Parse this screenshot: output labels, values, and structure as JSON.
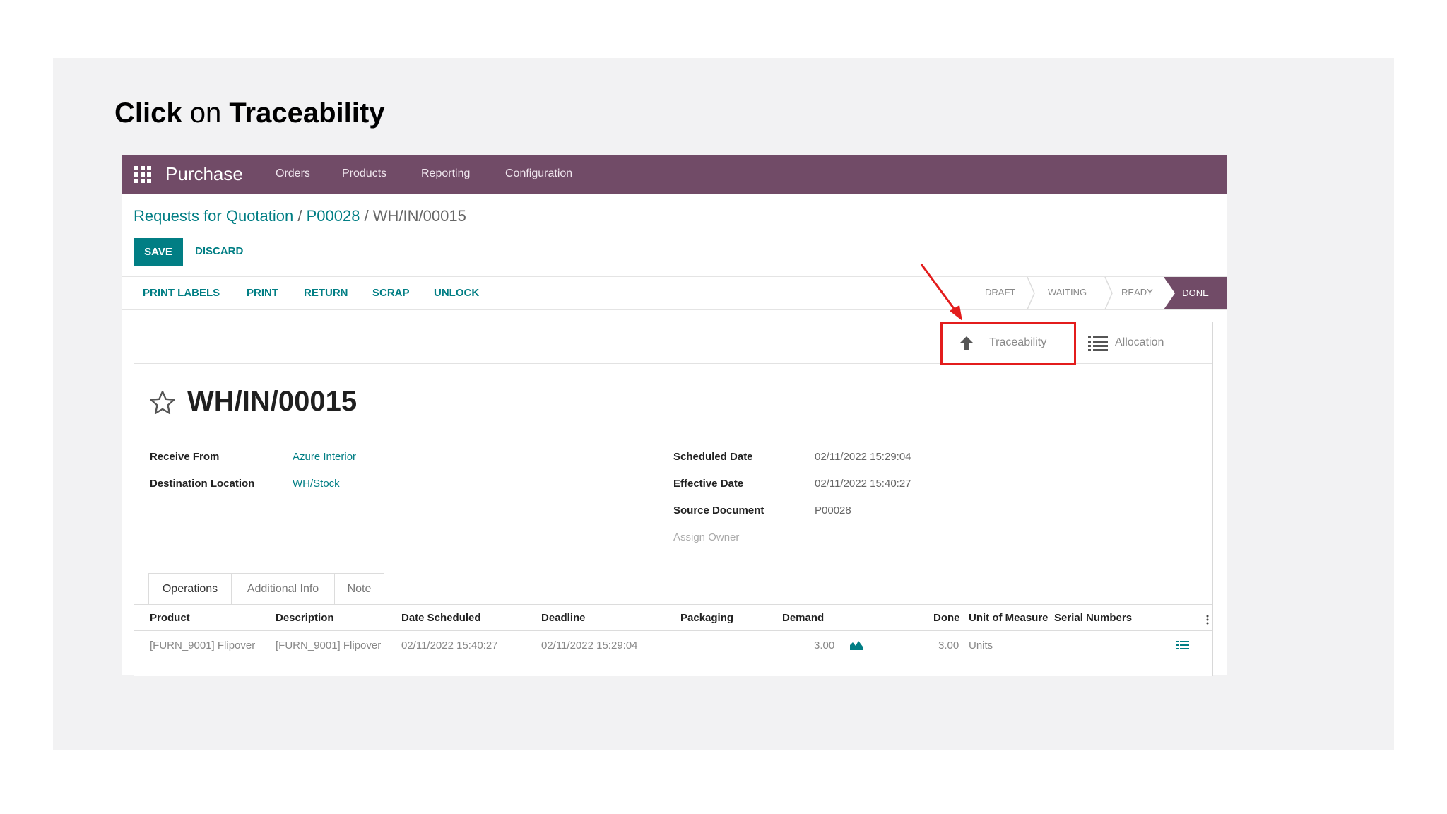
{
  "instruction": {
    "prefix": "Click",
    "middle": " on ",
    "target": "Traceability"
  },
  "navbar": {
    "app_name": "Purchase",
    "menu": [
      "Orders",
      "Products",
      "Reporting",
      "Configuration"
    ]
  },
  "breadcrumb": {
    "part1": "Requests for Quotation",
    "part2": "P00028",
    "current": "WH/IN/00015",
    "separator": " / "
  },
  "buttons": {
    "save": "SAVE",
    "discard": "DISCARD"
  },
  "actions": [
    "PRINT LABELS",
    "PRINT",
    "RETURN",
    "SCRAP",
    "UNLOCK"
  ],
  "status_stages": [
    "DRAFT",
    "WAITING",
    "READY",
    "DONE"
  ],
  "status_active": "DONE",
  "smart_buttons": {
    "traceability": "Traceability",
    "allocation": "Allocation"
  },
  "record": {
    "title": "WH/IN/00015",
    "receive_from_label": "Receive From",
    "receive_from": "Azure Interior",
    "destination_label": "Destination Location",
    "destination": "WH/Stock",
    "scheduled_label": "Scheduled Date",
    "scheduled": "02/11/2022 15:29:04",
    "effective_label": "Effective Date",
    "effective": "02/11/2022 15:40:27",
    "source_label": "Source Document",
    "source": "P00028",
    "assign_owner": "Assign Owner"
  },
  "tabs": [
    "Operations",
    "Additional Info",
    "Note"
  ],
  "table": {
    "headers": [
      "Product",
      "Description",
      "Date Scheduled",
      "Deadline",
      "Packaging",
      "Demand",
      "Done",
      "Unit of Measure",
      "Serial Numbers"
    ],
    "rows": [
      [
        "[FURN_9001] Flipover",
        "[FURN_9001] Flipover",
        "02/11/2022 15:40:27",
        "02/11/2022 15:29:04",
        "",
        "3.00",
        "3.00",
        "Units",
        ""
      ]
    ]
  },
  "colors": {
    "brand": "#714b67",
    "accent": "#017e84",
    "highlight": "#e31c1c"
  }
}
